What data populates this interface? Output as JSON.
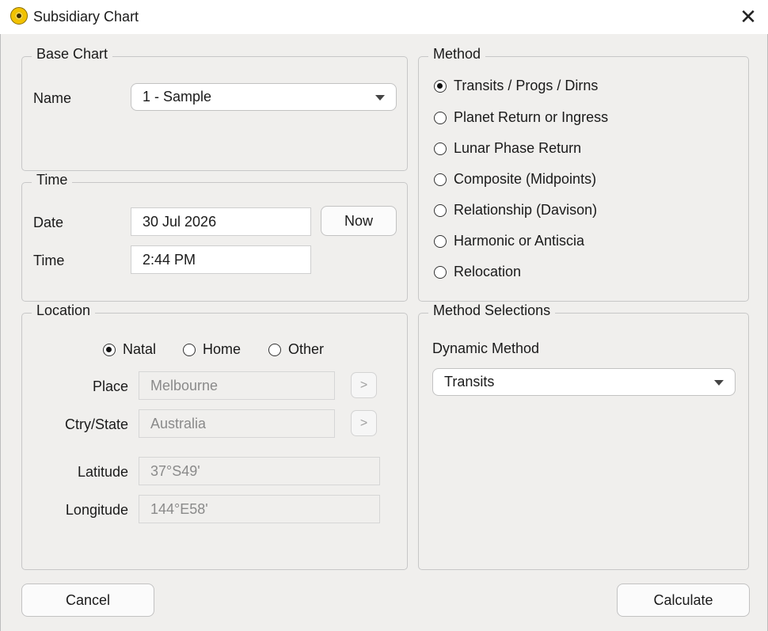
{
  "window": {
    "title": "Subsidiary Chart",
    "icon": "app-sun-icon"
  },
  "base_chart": {
    "legend": "Base Chart",
    "name_label": "Name",
    "name_value": "1 - Sample"
  },
  "time": {
    "legend": "Time",
    "date_label": "Date",
    "date_value": "30 Jul 2026",
    "now_label": "Now",
    "time_label": "Time",
    "time_value": "2:44 PM"
  },
  "location": {
    "legend": "Location",
    "options": [
      {
        "label": "Natal",
        "selected": true
      },
      {
        "label": "Home",
        "selected": false
      },
      {
        "label": "Other",
        "selected": false
      }
    ],
    "place_label": "Place",
    "place_value": "Melbourne",
    "country_label": "Ctry/State",
    "country_value": "Australia",
    "latitude_label": "Latitude",
    "latitude_value": "37°S49'",
    "longitude_label": "Longitude",
    "longitude_value": "144°E58'",
    "go_label": ">"
  },
  "method": {
    "legend": "Method",
    "options": [
      {
        "label": "Transits / Progs / Dirns",
        "selected": true
      },
      {
        "label": "Planet Return or Ingress",
        "selected": false
      },
      {
        "label": "Lunar Phase Return",
        "selected": false
      },
      {
        "label": "Composite (Midpoints)",
        "selected": false
      },
      {
        "label": "Relationship (Davison)",
        "selected": false
      },
      {
        "label": "Harmonic or Antiscia",
        "selected": false
      },
      {
        "label": "Relocation",
        "selected": false
      }
    ]
  },
  "method_selections": {
    "legend": "Method Selections",
    "dynamic_label": "Dynamic Method",
    "dynamic_value": "Transits"
  },
  "footer": {
    "cancel_label": "Cancel",
    "calculate_label": "Calculate"
  }
}
